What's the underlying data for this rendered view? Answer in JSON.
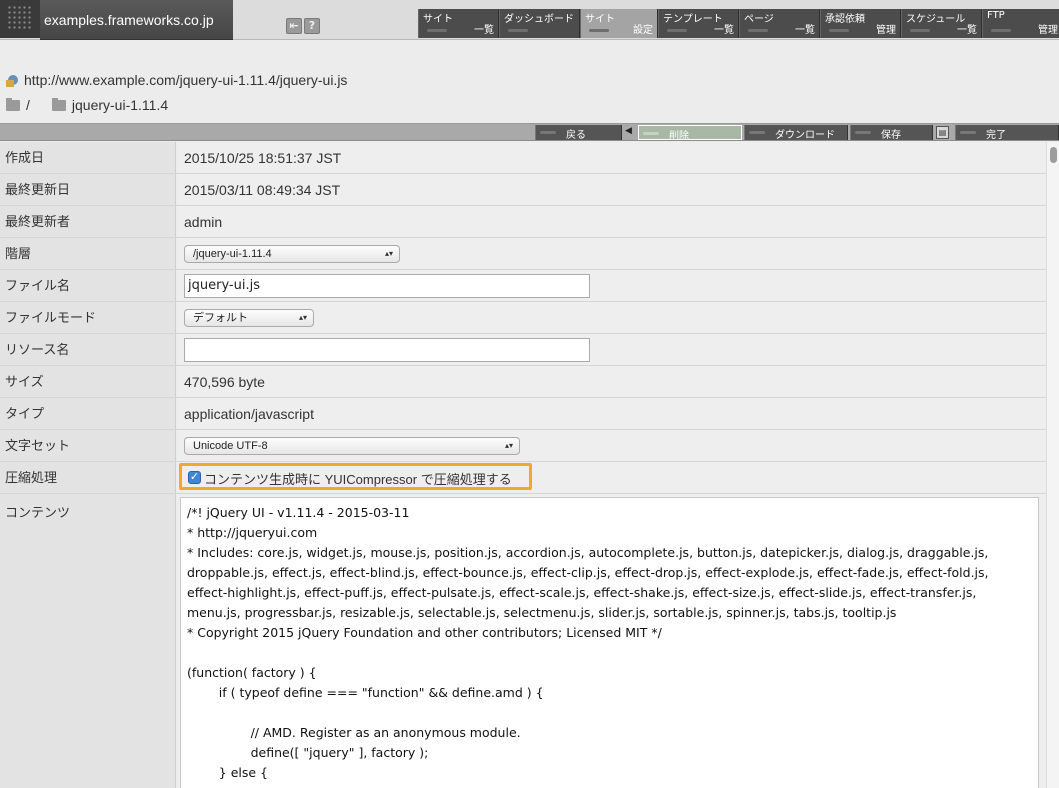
{
  "site": {
    "name": "examples.frameworks.co.jp"
  },
  "header_icons": [
    "exit-icon",
    "help-icon"
  ],
  "nav": [
    {
      "line1": "サイト",
      "line2": "一覧",
      "active": false
    },
    {
      "line1": "ダッシュボード",
      "line2": "",
      "active": false
    },
    {
      "line1": "サイト",
      "line2": "設定",
      "active": true
    },
    {
      "line1": "テンプレート",
      "line2": "一覧",
      "active": false
    },
    {
      "line1": "ページ",
      "line2": "一覧",
      "active": false
    },
    {
      "line1": "承認依頼",
      "line2": "管理",
      "active": false
    },
    {
      "line1": "スケジュール",
      "line2": "一覧",
      "active": false
    },
    {
      "line1": "FTP",
      "line2": "管理",
      "active": false
    }
  ],
  "path": {
    "url": "http://www.example.com/jquery-ui-1.11.4/jquery-ui.js",
    "root": "/",
    "folder": "jquery-ui-1.11.4"
  },
  "actions": {
    "back": "戻る",
    "delete": "削除",
    "download": "ダウンロード",
    "save": "保存",
    "done": "完了"
  },
  "form": {
    "created": {
      "label": "作成日",
      "value": "2015/10/25 18:51:37 JST"
    },
    "modified": {
      "label": "最終更新日",
      "value": "2015/03/11 08:49:34 JST"
    },
    "modifier": {
      "label": "最終更新者",
      "value": "admin"
    },
    "hierarchy": {
      "label": "階層",
      "value": "/jquery-ui-1.11.4"
    },
    "filename": {
      "label": "ファイル名",
      "value": "jquery-ui.js"
    },
    "filemode": {
      "label": "ファイルモード",
      "value": "デフォルト"
    },
    "resource": {
      "label": "リソース名",
      "value": ""
    },
    "size": {
      "label": "サイズ",
      "value": "470,596 byte"
    },
    "type": {
      "label": "タイプ",
      "value": "application/javascript"
    },
    "charset": {
      "label": "文字セット",
      "value": "Unicode UTF-8"
    },
    "compress": {
      "label": "圧縮処理",
      "checkbox_label": "コンテンツ生成時に YUICompressor で圧縮処理する",
      "checked": true
    },
    "content": {
      "label": "コンテンツ",
      "text": "/*! jQuery UI - v1.11.4 - 2015-03-11\n* http://jqueryui.com\n* Includes: core.js, widget.js, mouse.js, position.js, accordion.js, autocomplete.js, button.js, datepicker.js, dialog.js, draggable.js,\ndroppable.js, effect.js, effect-blind.js, effect-bounce.js, effect-clip.js, effect-drop.js, effect-explode.js, effect-fade.js, effect-fold.js,\neffect-highlight.js, effect-puff.js, effect-pulsate.js, effect-scale.js, effect-shake.js, effect-size.js, effect-slide.js, effect-transfer.js,\nmenu.js, progressbar.js, resizable.js, selectable.js, selectmenu.js, slider.js, sortable.js, spinner.js, tabs.js, tooltip.js\n* Copyright 2015 jQuery Foundation and other contributors; Licensed MIT */\n\n(function( factory ) {\n        if ( typeof define === \"function\" && define.amd ) {\n\n                // AMD. Register as an anonymous module.\n                define([ \"jquery\" ], factory );\n        } else {"
    }
  },
  "colors": {
    "highlight": "#f0a830",
    "nav_active": "#a4a4a4",
    "checkbox": "#3f86d4"
  }
}
